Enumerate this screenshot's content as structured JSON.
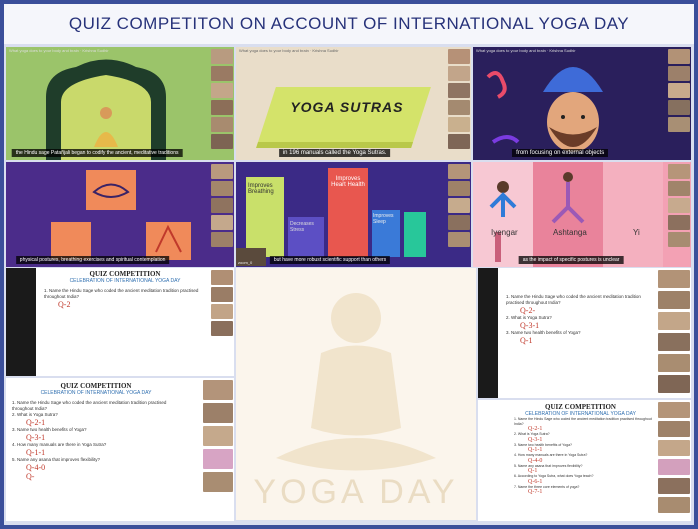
{
  "title": "QUIZ COMPETITON ON ACCOUNT OF INTERNATIONAL YOGA DAY",
  "tiles": {
    "sage": {
      "caption": "the Hindu sage Patañjali began to codify the ancient, meditative traditions",
      "top_text": "What yoga does to your body and brain · Krishna Sudhir"
    },
    "sutras": {
      "book_label": "YOGA SUTRAS",
      "caption": "in 196 manuals called the Yoga Sutras.",
      "top_text": "What yoga does to your body and brain · Krishna Sudhir"
    },
    "face": {
      "caption": "from focusing on external objects",
      "top_text": "What yoga does to your body and brain · Krishna Sudhir"
    },
    "postures": {
      "caption": "physical postures, breathing exercises and spiritual contemplation"
    },
    "bars": {
      "bar1": "Improves Breathing",
      "bar2": "Decreases Stress",
      "bar3": "Improves Heart Health",
      "bar4": "Improves Sleep",
      "caption": "but have more robust scientific support than others",
      "user": "zoom_0"
    },
    "poses": {
      "label1": "Iyengar",
      "label2": "Ashtanga",
      "label3": "Yi",
      "caption": "as the impact of specific postures is unclear"
    }
  },
  "watermark": "YOGA DAY",
  "doc_left_small": {
    "heading": "QUIZ COMPETITION",
    "sub": "CELEBRATION OF INTERNATIONAL YOGA DAY",
    "q1": "1. Name the Hindu Sage who coded the ancient meditation tradition practised throughout India?",
    "a1": "Q-2"
  },
  "doc_left_big": {
    "heading": "QUIZ COMPETITION",
    "sub": "CELEBRATION OF INTERNATIONAL YOGA DAY",
    "questions": [
      "1. Name the Hindu Sage who coded the ancient meditation tradition practised throughout India?",
      "2. What is Yoga Sutra?",
      "3. Name two health benefits of Yoga?",
      "4. How many manuals are there in Yoga Sutra?",
      "5. Name any asana that improves flexibility?"
    ],
    "answers": [
      "Q-2-1",
      "Q-3-1",
      "Q-1-1",
      "Q-4-0",
      "Q-"
    ]
  },
  "doc_right_small": {
    "questions": [
      "1. Name the Hindu Sage who coded the ancient meditation tradition practised throughout India?",
      "2. What is Yoga Sutra?",
      "3. Name two health benefits of Yoga?"
    ],
    "answers": [
      "Q-2-",
      "Q-3-1",
      "Q-1"
    ]
  },
  "doc_right_big": {
    "heading": "QUIZ COMPETITION",
    "sub": "CELEBRATION OF INTERNATIONAL YOGA DAY",
    "questions": [
      "1. Name the Hindu Sage who coded the ancient meditation tradition practised throughout India?",
      "2. What is Yoga Sutra?",
      "3. Name two health benefits of Yoga?",
      "4. How many manuals are there in Yoga Sutra?",
      "5. Name any asana that improves flexibility?",
      "6. According to Yoga Sutra, what does Yoga teach?",
      "7. Name the three core elements of yoga?"
    ],
    "answers": [
      "Q-2-1",
      "Q-3-1",
      "Q-1-1",
      "Q-4-0",
      "Q-1",
      "Q-6-1",
      "Q-7-1"
    ]
  },
  "colors": {
    "accent": "#27327a",
    "frame": "#3b4f9a",
    "answer": "#c0392b"
  }
}
